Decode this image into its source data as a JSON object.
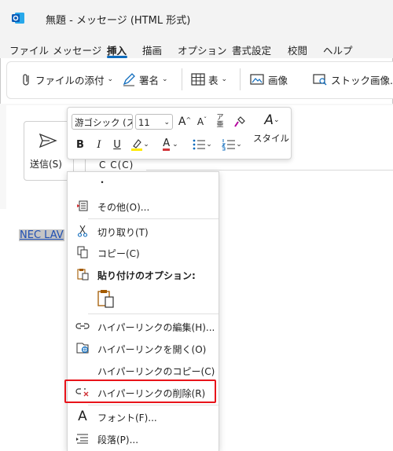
{
  "window": {
    "title": "無題 - メッセージ (HTML 形式)"
  },
  "ribbon_tabs": [
    {
      "label": "ファイル"
    },
    {
      "label": "メッセージ"
    },
    {
      "label": "挿入"
    },
    {
      "label": "描画"
    },
    {
      "label": "オプション"
    },
    {
      "label": "書式設定"
    },
    {
      "label": "校閲"
    },
    {
      "label": "ヘルプ"
    }
  ],
  "active_tab": "挿入",
  "ribbon": {
    "attach_file": "ファイルの添付",
    "signature": "署名",
    "table": "表",
    "image": "画像",
    "stock_images": "ストック画像..."
  },
  "compose": {
    "send_label": "送信(S)",
    "cc_label": "C C(C)",
    "link_text": "NEC LAV"
  },
  "mini_toolbar": {
    "font_name": "游ゴシック (ス",
    "font_size": "11",
    "grow": "A",
    "shrink": "A",
    "bold": "B",
    "italic": "I",
    "underline": "U",
    "font_color": "A",
    "styles_label": "スタイル",
    "highlight_color": "#ffea00",
    "font_color_value": "#d13438"
  },
  "context_menu": {
    "dot_item": "・",
    "items": [
      {
        "label": "その他(O)..."
      },
      {
        "label": "切り取り(T)"
      },
      {
        "label": "コピー(C)"
      },
      {
        "label": "貼り付けのオプション:"
      },
      {
        "label": "ハイパーリンクの編集(H)..."
      },
      {
        "label": "ハイパーリンクを開く(O)"
      },
      {
        "label": "ハイパーリンクのコピー(C)"
      },
      {
        "label": "ハイパーリンクの削除(R)"
      },
      {
        "label": "フォント(F)..."
      },
      {
        "label": "段落(P)..."
      }
    ]
  },
  "colors": {
    "accent": "#0f6cbd",
    "highlight_border": "#e8131a",
    "link": "#1f4fb3"
  }
}
